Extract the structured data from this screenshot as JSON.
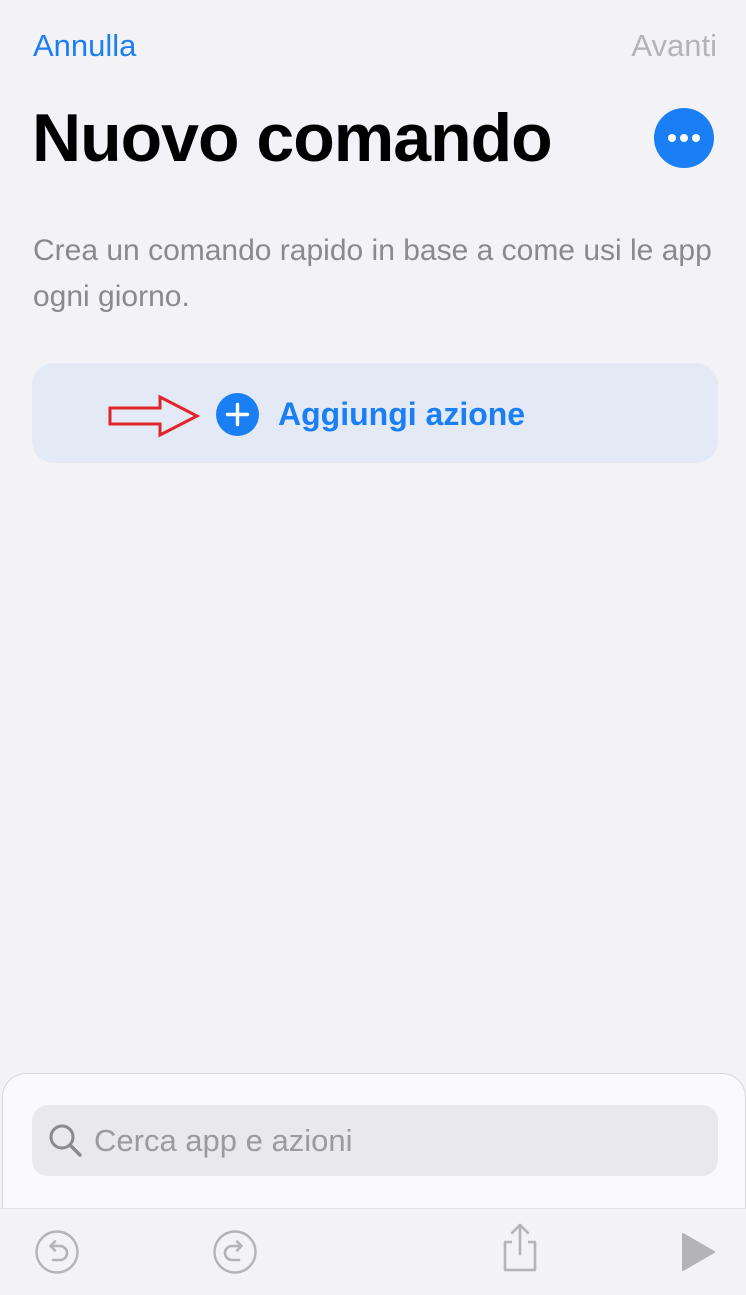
{
  "nav": {
    "cancel_label": "Annulla",
    "next_label": "Avanti"
  },
  "header": {
    "title": "Nuovo comando"
  },
  "main": {
    "description": "Crea un comando rapido in base a come usi le app ogni giorno.",
    "add_action_label": "Aggiungi azione"
  },
  "search": {
    "placeholder": "Cerca app e azioni"
  },
  "icons": {
    "more": "ellipsis-icon",
    "add": "plus-circle-icon",
    "annotation": "red-arrow-icon",
    "search": "magnifier-icon",
    "undo": "undo-icon",
    "redo": "redo-icon",
    "share": "share-icon",
    "run": "play-icon"
  },
  "colors": {
    "accent": "#1a7ff5",
    "background": "#f2f2f7",
    "disabled": "#b3b3b8",
    "annotation": "#e0262b"
  }
}
